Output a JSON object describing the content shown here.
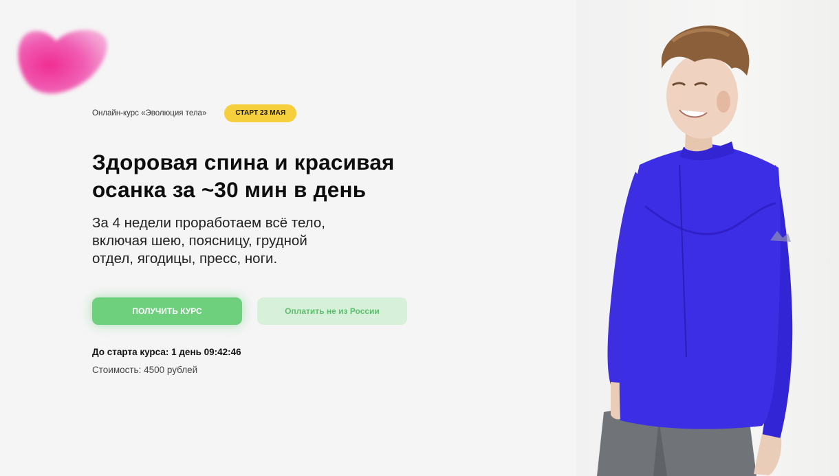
{
  "course": {
    "name": "Онлайн-курс «Эволюция тела»",
    "start_badge": "СТАРТ 23 МАЯ"
  },
  "hero": {
    "headline_line1": "Здоровая спина и красивая",
    "headline_line2": "осанка за ~30 мин в день",
    "subtitle_line1": "За 4 недели проработаем всё тело,",
    "subtitle_line2": "включая шею, поясницу, грудной",
    "subtitle_line3": "отдел, ягодицы, пресс, ноги."
  },
  "buttons": {
    "get_course": "ПОЛУЧИТЬ КУРС",
    "pay_abroad": "Оплатить не из России"
  },
  "info": {
    "countdown": "До старта курса: 1 день 09:42:46",
    "price": "Стоимость: 4500 рублей"
  },
  "colors": {
    "accent_green": "#6ecf7d",
    "badge_yellow": "#f5cf3c",
    "logo_pink": "#ee3fa2",
    "shirt_blue": "#3d2fe0"
  },
  "icons": {
    "logo": "heart-blob-logo"
  }
}
